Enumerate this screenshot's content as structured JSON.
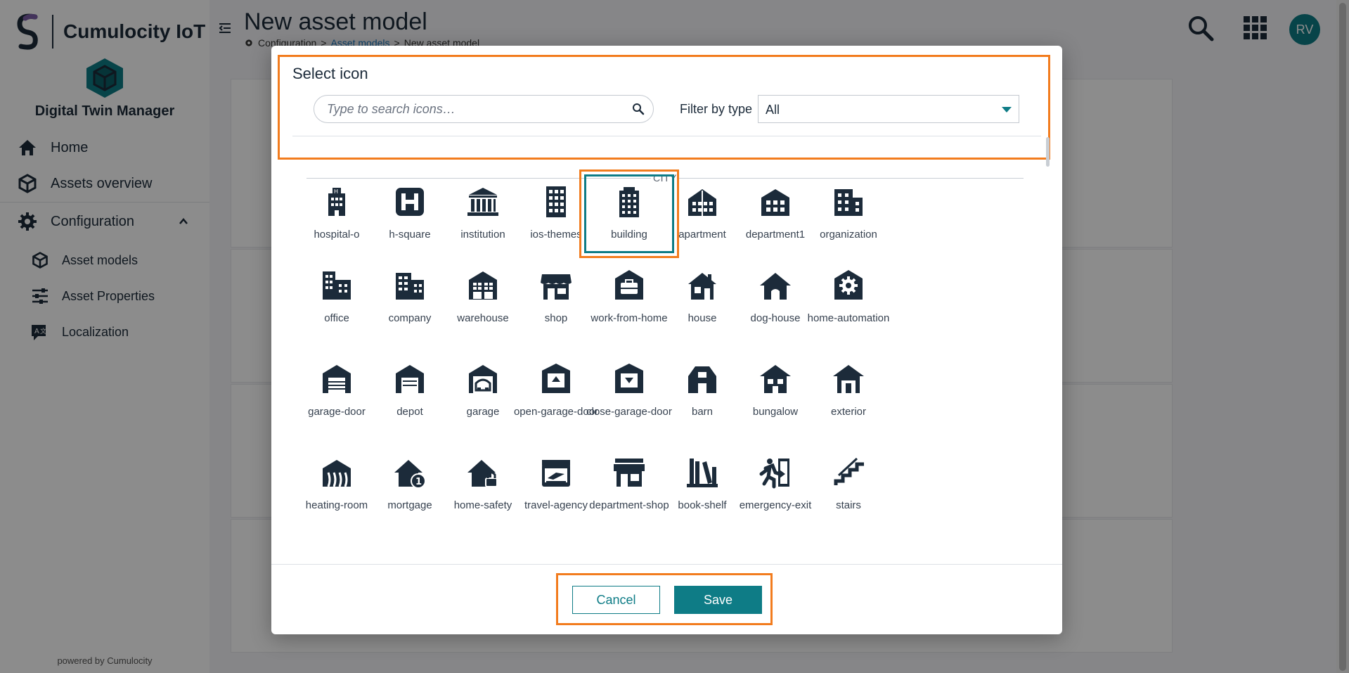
{
  "app": {
    "name": "Cumulocity IoT",
    "product": "Digital Twin Manager",
    "powered_by": "powered by Cumulocity"
  },
  "sidebar": {
    "items": [
      {
        "label": "Home",
        "icon": "home-icon"
      },
      {
        "label": "Assets overview",
        "icon": "cube-icon"
      },
      {
        "label": "Configuration",
        "icon": "gear-icon",
        "expanded": true
      }
    ],
    "sub_items": [
      {
        "label": "Asset models",
        "icon": "cube-icon"
      },
      {
        "label": "Asset Properties",
        "icon": "sliders-icon"
      },
      {
        "label": "Localization",
        "icon": "translate-icon"
      }
    ]
  },
  "header": {
    "title": "New asset model",
    "breadcrumb": [
      "Configuration",
      "Asset models",
      "New asset model"
    ],
    "avatar": "RV"
  },
  "modal": {
    "title": "Select icon",
    "search_placeholder": "Type to search icons…",
    "filter_label": "Filter by type",
    "filter_value": "All",
    "section": "CITY",
    "icons": [
      {
        "name": "hospital-o"
      },
      {
        "name": "h-square"
      },
      {
        "name": "institution"
      },
      {
        "name": "ios-themes"
      },
      {
        "name": "building",
        "selected": true
      },
      {
        "name": "apartment"
      },
      {
        "name": "department1"
      },
      {
        "name": "organization"
      },
      {
        "name": "office"
      },
      {
        "name": "company"
      },
      {
        "name": "warehouse"
      },
      {
        "name": "shop"
      },
      {
        "name": "work-from-home"
      },
      {
        "name": "house"
      },
      {
        "name": "dog-house"
      },
      {
        "name": "home-automation"
      },
      {
        "name": "garage-door"
      },
      {
        "name": "depot"
      },
      {
        "name": "garage"
      },
      {
        "name": "open-garage-door"
      },
      {
        "name": "close-garage-door"
      },
      {
        "name": "barn"
      },
      {
        "name": "bungalow"
      },
      {
        "name": "exterior"
      },
      {
        "name": "heating-room"
      },
      {
        "name": "mortgage"
      },
      {
        "name": "home-safety"
      },
      {
        "name": "travel-agency"
      },
      {
        "name": "department-shop"
      },
      {
        "name": "book-shelf"
      },
      {
        "name": "emergency-exit"
      },
      {
        "name": "stairs"
      }
    ],
    "cancel_label": "Cancel",
    "save_label": "Save"
  },
  "colors": {
    "accent": "#0e7c86",
    "highlight": "#f27c1e",
    "icon": "#1c2b3a"
  }
}
